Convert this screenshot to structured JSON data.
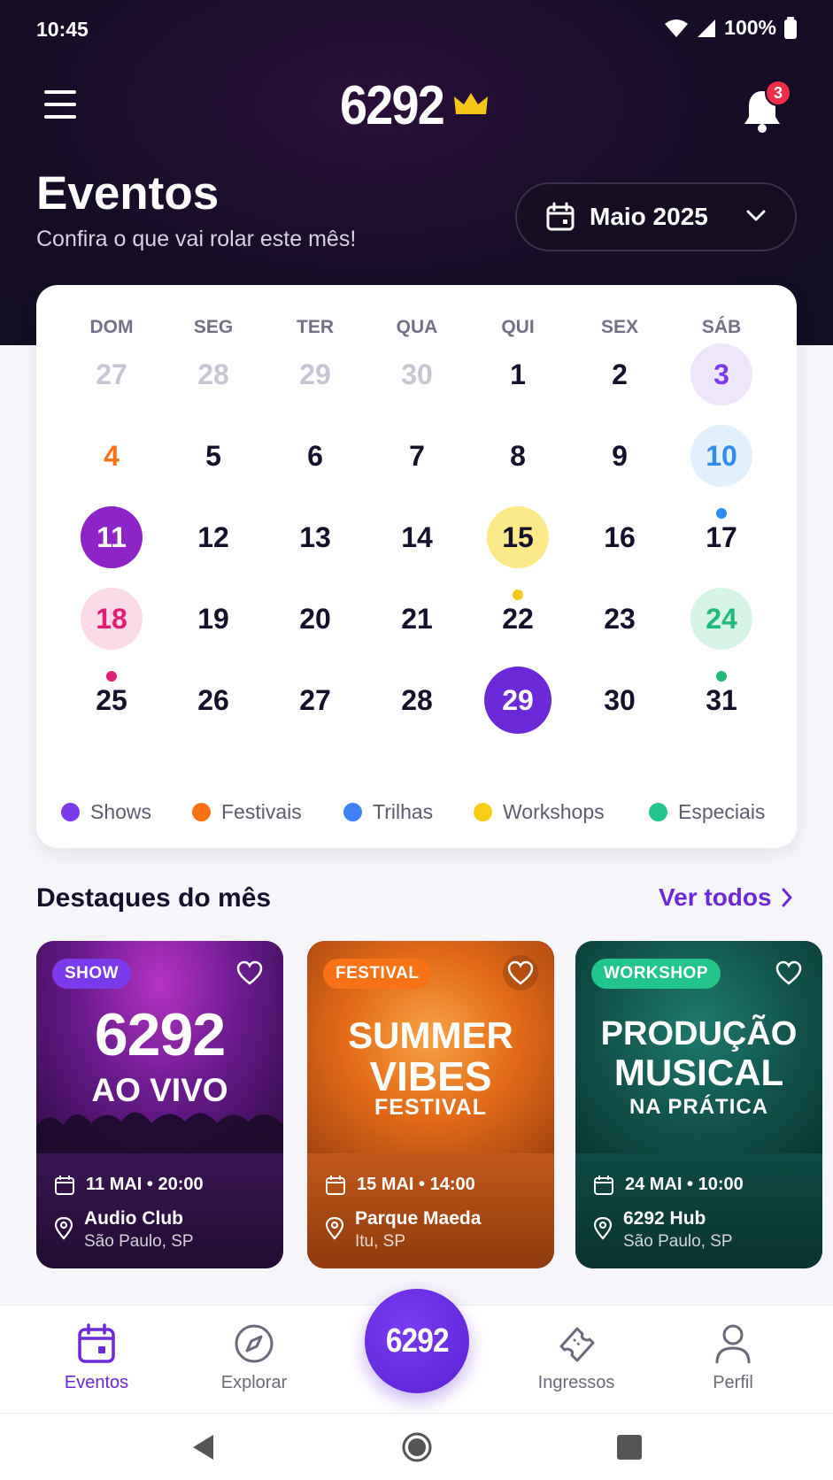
{
  "status_bar": {
    "time": "10:45",
    "battery": "100%"
  },
  "header": {
    "logo": "6292",
    "notification_count": "3",
    "title": "Eventos",
    "subtitle": "Confira o que vai rolar este mês!",
    "month_selector": "Maio 2025"
  },
  "calendar": {
    "weekdays": [
      "DOM",
      "SEG",
      "TER",
      "QUA",
      "QUI",
      "SEX",
      "SÁB"
    ],
    "rows": [
      [
        "27",
        "28",
        "29",
        "30",
        "1",
        "2",
        "3"
      ],
      [
        "4",
        "5",
        "6",
        "7",
        "8",
        "9",
        "10"
      ],
      [
        "11",
        "12",
        "13",
        "14",
        "15",
        "16",
        "17"
      ],
      [
        "18",
        "19",
        "20",
        "21",
        "22",
        "23",
        "24"
      ],
      [
        "25",
        "26",
        "27",
        "28",
        "29",
        "30",
        "31"
      ]
    ],
    "muted_days": [
      "27",
      "28",
      "29",
      "30"
    ],
    "event_days": [
      {
        "day": "3",
        "category": "Shows"
      },
      {
        "day": "4",
        "category": "Festivais"
      },
      {
        "day": "10",
        "category": "Trilhas"
      },
      {
        "day": "11",
        "category": "Shows"
      },
      {
        "day": "15",
        "category": "Workshops"
      },
      {
        "day": "18",
        "category": "Especiais"
      },
      {
        "day": "24",
        "category": "Especiais"
      }
    ],
    "today": "29",
    "legend": [
      {
        "label": "Shows",
        "color": "#7c3aed"
      },
      {
        "label": "Festivais",
        "color": "#f97316"
      },
      {
        "label": "Trilhas",
        "color": "#3b82f6"
      },
      {
        "label": "Workshops",
        "color": "#facc15"
      },
      {
        "label": "Especiais",
        "color": "#22c58b"
      }
    ],
    "colors": {
      "shows": "#7c3aed",
      "festivais": "#f97316",
      "trilhas": "#2f8cf0",
      "workshops": "#f5c518",
      "especiais_pink": "#e11d74",
      "especiais_green": "#1fb97a",
      "today": "#6d28d9"
    }
  },
  "highlights": {
    "title": "Destaques do mês",
    "see_all": "Ver todos",
    "cards": [
      {
        "badge": "SHOW",
        "art_line1": "6292",
        "art_line2": "AO VIVO",
        "date": "11 MAI • 20:00",
        "venue": "Audio Club",
        "city": "São Paulo, SP"
      },
      {
        "badge": "FESTIVAL",
        "art_line1": "SUMMER",
        "art_line2": "VIBES",
        "art_line3": "FESTIVAL",
        "date": "15 MAI • 14:00",
        "venue": "Parque Maeda",
        "city": "Itu, SP"
      },
      {
        "badge": "WORKSHOP",
        "art_line1": "PRODUÇÃO",
        "art_line2": "MUSICAL",
        "art_line3": "NA PRÁTICA",
        "date": "24 MAI • 10:00",
        "venue": "6292 Hub",
        "city": "São Paulo, SP"
      }
    ]
  },
  "bottom_nav": {
    "items": [
      "Eventos",
      "Explorar",
      "Ingressos",
      "Perfil"
    ],
    "center_button": "6292",
    "active": "Eventos"
  },
  "icons": [
    "menu-icon",
    "crown-icon",
    "bell-icon",
    "calendar-icon",
    "chevron-down-icon",
    "chevron-right-icon",
    "heart-icon",
    "location-pin-icon",
    "compass-icon",
    "ticket-icon",
    "user-icon",
    "back-icon",
    "home-icon",
    "recents-icon"
  ]
}
